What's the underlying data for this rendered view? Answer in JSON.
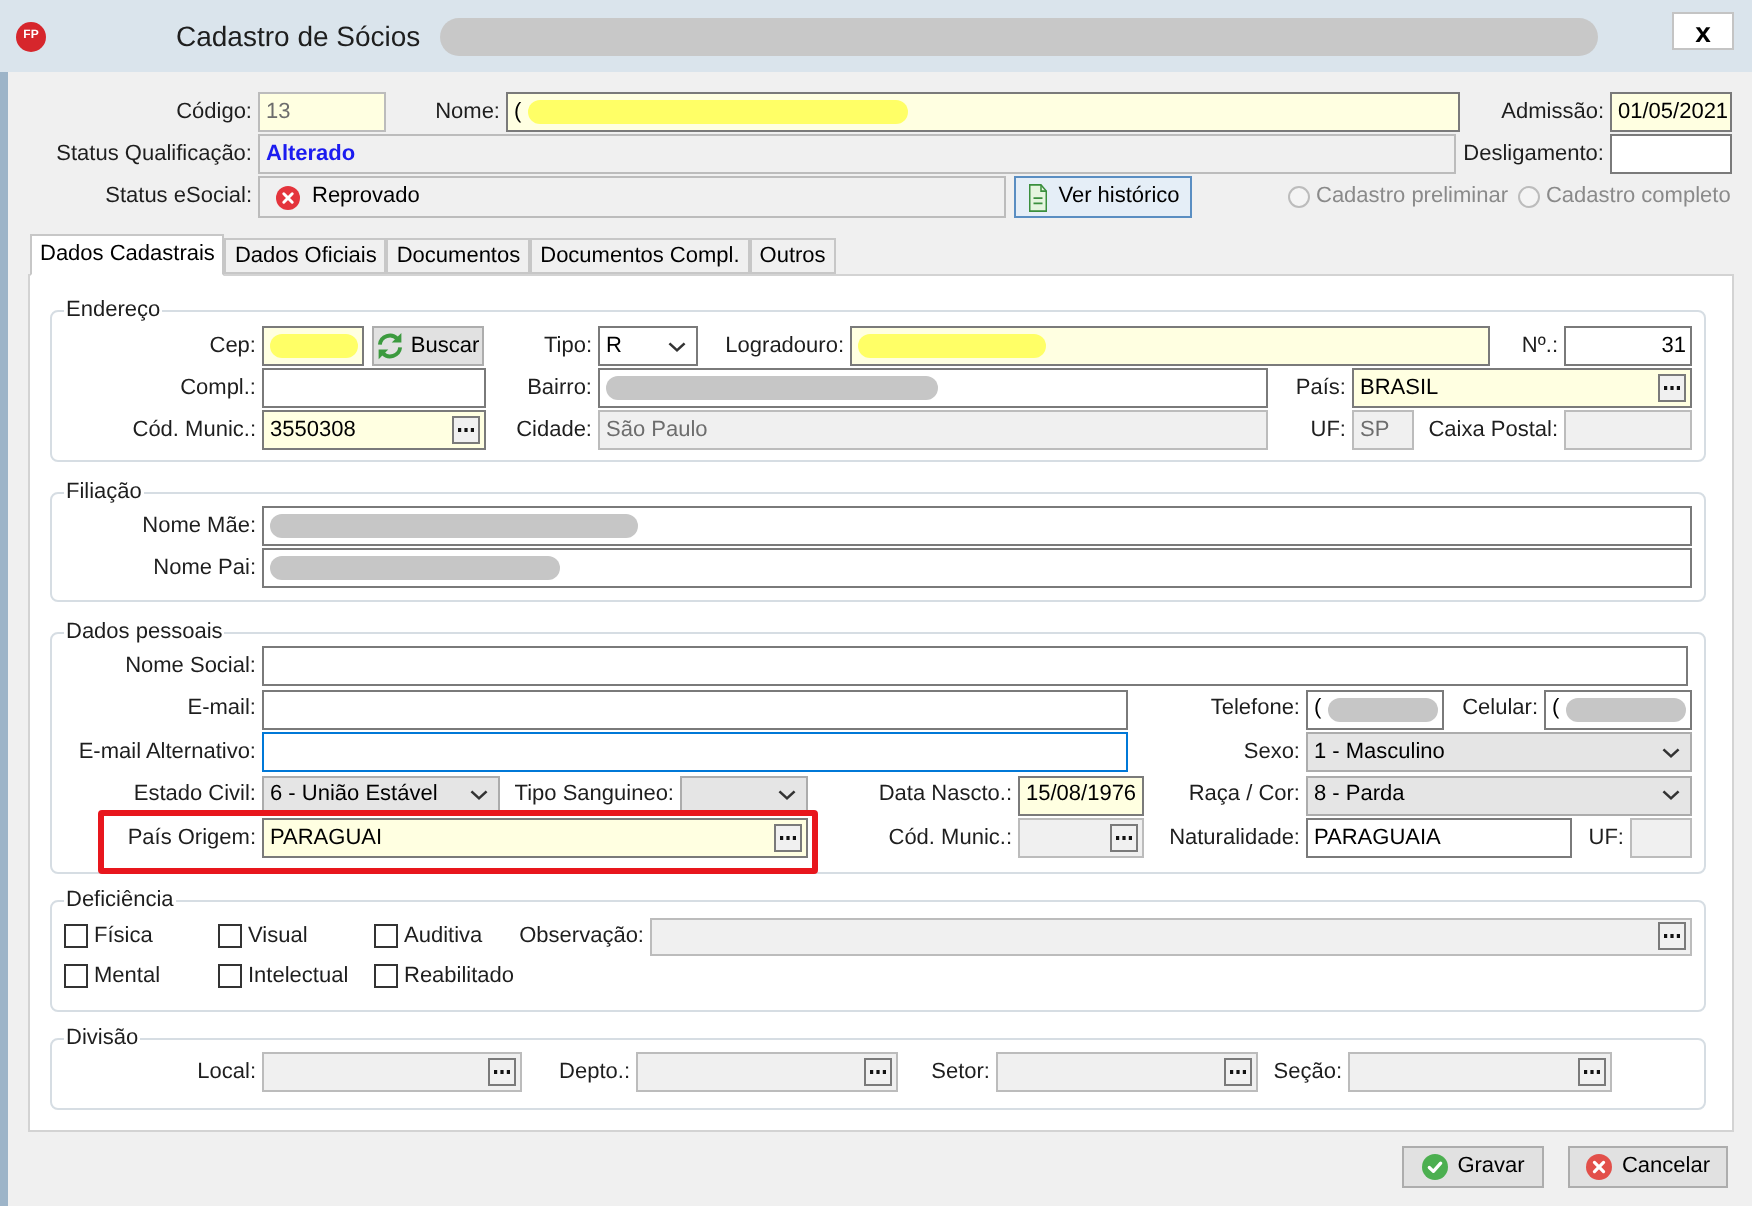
{
  "window": {
    "app_icon_text": "FP",
    "title": "Cadastro de Sócios",
    "redaction": {
      "color": "#c8c8c8"
    },
    "close_label": "x"
  },
  "header": {
    "fields": [
      {
        "label": "Código:",
        "kind": "text",
        "value": "13",
        "required": true,
        "disabled": true
      },
      {
        "label": "Nome:",
        "kind": "text",
        "value": "(",
        "redaction": {
          "color": "#ffff66"
        },
        "required": true,
        "disabled": false
      },
      {
        "label": "Admissão:",
        "kind": "text",
        "value": "01/05/2021",
        "required": true,
        "disabled": false
      },
      {
        "label": "Status Qualificação:",
        "kind": "status",
        "value": "Alterado",
        "required": false,
        "disabled": true
      },
      {
        "label": "Desligamento:",
        "kind": "text",
        "required": false,
        "disabled": false
      },
      {
        "label": "Status eSocial:",
        "kind": "status_icon",
        "value": "Reprovado",
        "required": false,
        "disabled": true
      }
    ],
    "history_button": {
      "label": "Ver histórico"
    },
    "registration_type": [
      {
        "label": "Cadastro preliminar",
        "selected": false,
        "disabled": true
      },
      {
        "label": "Cadastro completo",
        "selected": false,
        "disabled": true
      }
    ]
  },
  "tabs": [
    {
      "label": "Dados Cadastrais",
      "selected": true
    },
    {
      "label": "Dados Oficiais",
      "selected": false
    },
    {
      "label": "Documentos",
      "selected": false
    },
    {
      "label": "Documentos Compl.",
      "selected": false
    },
    {
      "label": "Outros",
      "selected": false
    }
  ],
  "address": {
    "title": "Endereço",
    "fields": [
      {
        "label": "Cep:",
        "kind": "text",
        "redaction": {
          "color": "#ffff66"
        },
        "required": true,
        "disabled": false
      },
      {
        "kind": "button",
        "label": "Buscar"
      },
      {
        "label": "Tipo:",
        "kind": "combo",
        "value": "R",
        "required": false,
        "disabled": false
      },
      {
        "label": "Logradouro:",
        "kind": "text",
        "redaction": {
          "color": "#ffff66"
        },
        "required": true,
        "disabled": false
      },
      {
        "label": "Nº.:",
        "kind": "number",
        "value": "31",
        "required": false,
        "disabled": false
      },
      {
        "label": "Compl.:",
        "kind": "text",
        "required": false,
        "disabled": false
      },
      {
        "label": "Bairro:",
        "kind": "text",
        "redaction": {
          "color": "#c6c6c6"
        },
        "required": false,
        "disabled": false
      },
      {
        "label": "País:",
        "kind": "lookup",
        "value": "BRASIL",
        "required": true,
        "disabled": false
      },
      {
        "label": "Cód. Munic.:",
        "kind": "lookup",
        "value": "3550308",
        "required": true,
        "disabled": false
      },
      {
        "label": "Cidade:",
        "kind": "text",
        "value": "São Paulo",
        "required": false,
        "disabled": true
      },
      {
        "label": "UF:",
        "kind": "text",
        "value": "SP",
        "required": false,
        "disabled": true
      },
      {
        "label": "Caixa Postal:",
        "kind": "text",
        "required": false,
        "disabled": true
      }
    ]
  },
  "parents": {
    "title": "Filiação",
    "fields": [
      {
        "label": "Nome Mãe:",
        "kind": "text",
        "redaction": {
          "color": "#c6c6c6"
        },
        "required": false,
        "disabled": false
      },
      {
        "label": "Nome Pai:",
        "kind": "text",
        "redaction": {
          "color": "#c6c6c6"
        },
        "required": false,
        "disabled": false
      }
    ]
  },
  "personal": {
    "title": "Dados pessoais",
    "fields": [
      {
        "label": "Nome Social:",
        "kind": "text",
        "required": false,
        "disabled": false,
        "focused": false,
        "highlighted": false
      },
      {
        "label": "E-mail:",
        "kind": "text",
        "required": false,
        "disabled": false,
        "focused": false,
        "highlighted": false
      },
      {
        "label": "Telefone:",
        "kind": "text",
        "value": "(",
        "redaction": {
          "color": "#c6c6c6"
        },
        "required": false,
        "disabled": false,
        "focused": false,
        "highlighted": false
      },
      {
        "label": "Celular:",
        "kind": "text",
        "value": "(",
        "redaction": {
          "color": "#c6c6c6"
        },
        "required": false,
        "disabled": false,
        "focused": false,
        "highlighted": false
      },
      {
        "label": "E-mail Alternativo:",
        "kind": "text",
        "required": false,
        "disabled": false,
        "focused": true,
        "highlighted": false
      },
      {
        "label": "Sexo:",
        "kind": "dropdown",
        "value": "1 - Masculino",
        "required": false,
        "disabled": false,
        "focused": false,
        "highlighted": false
      },
      {
        "label": "Estado Civil:",
        "kind": "dropdown",
        "value": "6 - União Estável",
        "required": false,
        "disabled": false,
        "focused": false,
        "highlighted": false
      },
      {
        "label": "Tipo Sanguineo:",
        "kind": "dropdown",
        "required": false,
        "disabled": false,
        "focused": false,
        "highlighted": false
      },
      {
        "label": "Data Nascto.:",
        "kind": "text",
        "value": "15/08/1976",
        "required": true,
        "disabled": false,
        "focused": false,
        "highlighted": false
      },
      {
        "label": "Raça / Cor:",
        "kind": "dropdown",
        "value": "8 - Parda",
        "required": false,
        "disabled": false,
        "focused": false,
        "highlighted": false
      },
      {
        "label": "País Origem:",
        "kind": "lookup",
        "value": "PARAGUAI",
        "required": true,
        "disabled": false,
        "focused": false,
        "highlighted": true
      },
      {
        "label": "Cód. Munic.:",
        "kind": "lookup",
        "required": false,
        "disabled": true,
        "focused": false,
        "highlighted": false
      },
      {
        "label": "Naturalidade:",
        "kind": "text",
        "value": "PARAGUAIA",
        "required": false,
        "disabled": false,
        "focused": false,
        "highlighted": false
      },
      {
        "label": "UF:",
        "kind": "text",
        "required": false,
        "disabled": true,
        "focused": false,
        "highlighted": false
      }
    ]
  },
  "disability": {
    "title": "Deficiência",
    "options": [
      {
        "label": "Física",
        "checked": false
      },
      {
        "label": "Visual",
        "checked": false
      },
      {
        "label": "Auditiva",
        "checked": false
      },
      {
        "label": "Mental",
        "checked": false
      },
      {
        "label": "Intelectual",
        "checked": false
      },
      {
        "label": "Reabilitado",
        "checked": false
      }
    ],
    "note": {
      "label": "Observação:",
      "kind": "lookup",
      "required": false,
      "disabled": true
    }
  },
  "division": {
    "title": "Divisão",
    "fields": [
      {
        "label": "Local:",
        "kind": "lookup",
        "required": false,
        "disabled": true
      },
      {
        "label": "Depto.:",
        "kind": "lookup",
        "required": false,
        "disabled": true
      },
      {
        "label": "Setor:",
        "kind": "lookup",
        "required": false,
        "disabled": true
      },
      {
        "label": "Seção:",
        "kind": "lookup",
        "required": false,
        "disabled": true
      }
    ]
  },
  "actions": [
    {
      "label": "Gravar",
      "kind": "save"
    },
    {
      "label": "Cancelar",
      "kind": "cancel"
    }
  ]
}
